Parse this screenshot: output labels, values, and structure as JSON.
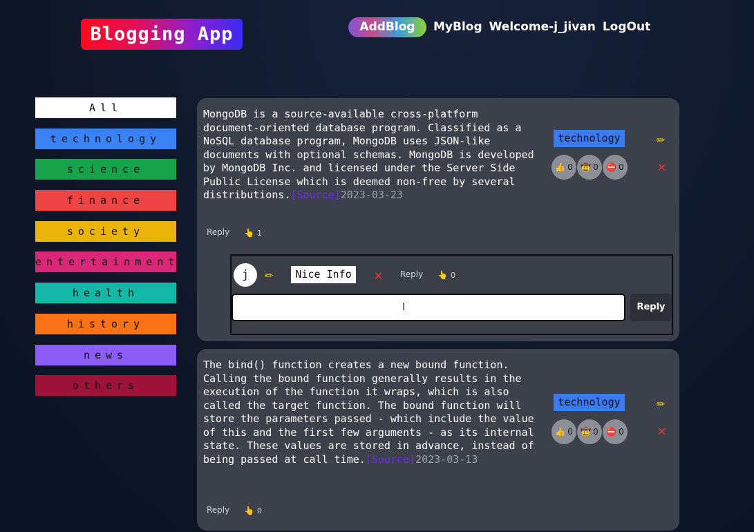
{
  "app": {
    "title": "Blogging App"
  },
  "nav": {
    "add": "AddBlog",
    "my": "MyBlog",
    "welcome": "Welcome-j_jivan",
    "logout": "LogOut"
  },
  "categories": [
    {
      "label": "All",
      "color": "#ffffff"
    },
    {
      "label": "technology",
      "color": "#3b82f6"
    },
    {
      "label": "science",
      "color": "#16a34a"
    },
    {
      "label": "finance",
      "color": "#ef4444"
    },
    {
      "label": "society",
      "color": "#eab308"
    },
    {
      "label": "entertainment",
      "color": "#db2777"
    },
    {
      "label": "health",
      "color": "#14b8a6"
    },
    {
      "label": "history",
      "color": "#f97316"
    },
    {
      "label": "news",
      "color": "#8b5cf6"
    },
    {
      "label": "others",
      "color": "#9f1239"
    }
  ],
  "posts": [
    {
      "text": "MongoDB is a source-available cross-platform document-oriented database program. Classified as a NoSQL database program, MongoDB uses JSON-like documents with optional schemas. MongoDB is developed by MongoDB Inc. and licensed under the Server Side Public License which is deemed non-free by several distributions.",
      "source": "[Source]",
      "date": "2023-03-23",
      "tag": "technology",
      "reactions": [
        {
          "icon": "👍",
          "count": "0"
        },
        {
          "icon": "🤠",
          "count": "0"
        },
        {
          "icon": "⛔",
          "count": "0"
        }
      ],
      "reply": "Reply",
      "likes": "1",
      "comment": {
        "avatar": "j",
        "text": "Nice Info",
        "reply": "Reply",
        "likes": "0",
        "input_value": "",
        "reply_button": "Reply"
      }
    },
    {
      "text": "The bind() function creates a new bound function. Calling the bound function generally results in the execution of the function it wraps, which is also called the target function. The bound function will store the parameters passed - which include the value of this and the first few arguments - as its internal state. These values are stored in advance, instead of being passed at call time.",
      "source": "[Source]",
      "date": "2023-03-13",
      "tag": "technology",
      "reactions": [
        {
          "icon": "👍",
          "count": "0"
        },
        {
          "icon": "🤠",
          "count": "0"
        },
        {
          "icon": "⛔",
          "count": "0"
        }
      ],
      "reply": "Reply",
      "likes": "0"
    }
  ]
}
